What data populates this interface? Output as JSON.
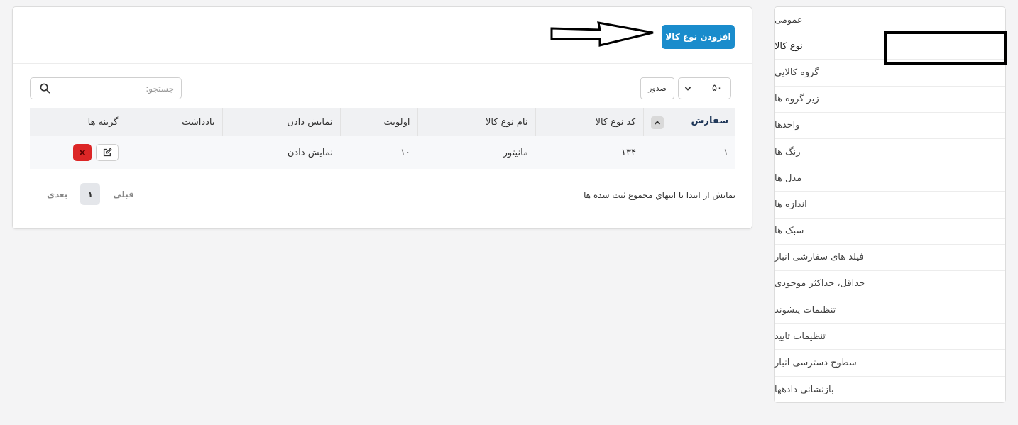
{
  "sidebar": {
    "items": [
      {
        "label": "عمومی"
      },
      {
        "label": "نوع کالا"
      },
      {
        "label": "گروه کالایی"
      },
      {
        "label": "زیر گروه ها"
      },
      {
        "label": "واحدها"
      },
      {
        "label": "رنگ ها"
      },
      {
        "label": "مدل ها"
      },
      {
        "label": "اندازه ها"
      },
      {
        "label": "سبک ها"
      },
      {
        "label": "فیلد های سفارشی انبار"
      },
      {
        "label": "حداقل، حداکثر موجودی"
      },
      {
        "label": "تنظیمات پیشوند"
      },
      {
        "label": "تنظیمات تایید"
      },
      {
        "label": "سطوح دسترسی انبار"
      },
      {
        "label": "بازنشانی دادهها"
      }
    ],
    "active_index": 1
  },
  "header": {
    "add_button_label": "افزودن نوع کالا"
  },
  "toolbar": {
    "search_placeholder": "جستجو:",
    "export_label": "صدور",
    "page_size": "۵۰"
  },
  "table": {
    "headers": {
      "order": "سفارش",
      "code": "کد نوع کالا",
      "name": "نام نوع کالا",
      "priority": "اولویت",
      "display": "نمایش دادن",
      "note": "یادداشت",
      "options": "گزینه ها"
    },
    "rows": [
      {
        "order": "۱",
        "code": "۱۳۴",
        "name": "مانیتور",
        "priority": "۱۰",
        "display": "نمایش دادن",
        "note": ""
      }
    ]
  },
  "footer": {
    "info": "نمایش از ابتدا تا انتهاي مجموع ثبت شده ها",
    "prev_label": "قبلي",
    "current_page": "۱",
    "next_label": "بعدي"
  },
  "colors": {
    "primary": "#1a8ccc",
    "danger": "#dc2626",
    "sorted_header": "#1d3557"
  }
}
